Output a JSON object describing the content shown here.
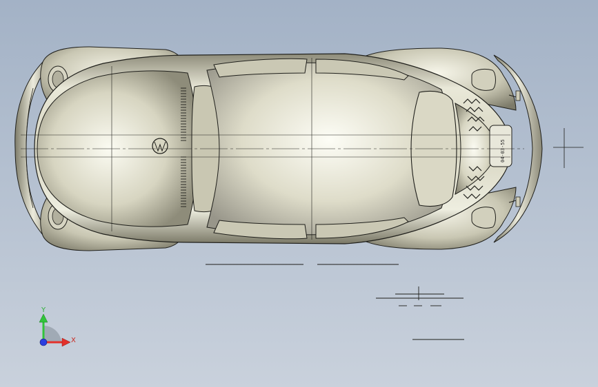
{
  "viewport": {
    "background_top": "#a3b2c6",
    "background_bottom": "#c9d1dc",
    "model": "car-body-top-view"
  },
  "model": {
    "body_color": "#dcdac6",
    "shadow_color": "#6e6c5c",
    "edge_color": "#1e1e1a",
    "plate_text": "04-03-55"
  },
  "triad": {
    "x_label": "X",
    "y_label": "Y",
    "x_color": "#e3312b",
    "y_color": "#31c43a",
    "z_color": "#2b3fe0"
  }
}
